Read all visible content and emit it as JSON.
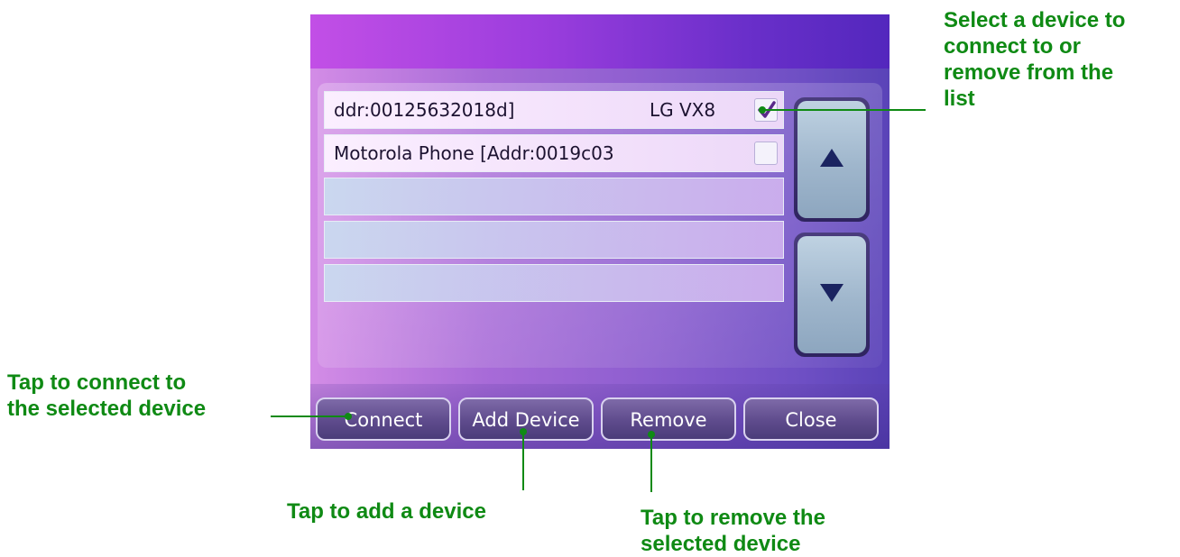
{
  "device_list": {
    "rows": [
      {
        "text": "ddr:00125632018d]",
        "right_text": "LG VX8",
        "checked": true
      },
      {
        "text": "Motorola Phone [Addr:0019c03",
        "checked": false
      },
      {
        "text": ""
      },
      {
        "text": ""
      },
      {
        "text": ""
      }
    ]
  },
  "scroll": {
    "up_icon": "triangle-up-icon",
    "down_icon": "triangle-down-icon"
  },
  "toolbar": {
    "connect_label": "Connect",
    "add_device_label": "Add Device",
    "remove_label": "Remove",
    "close_label": "Close"
  },
  "callouts": {
    "select_line1": "Select a device to",
    "select_line2": "connect to or",
    "select_line3": "remove from the",
    "select_line4": "list",
    "connect_line1": "Tap to connect to",
    "connect_line2": "the selected device",
    "add": "Tap to add a device",
    "remove_line1": "Tap to remove the",
    "remove_line2": "selected device"
  },
  "colors": {
    "callout": "#0f8a14",
    "accent": "#9b3ddd"
  }
}
